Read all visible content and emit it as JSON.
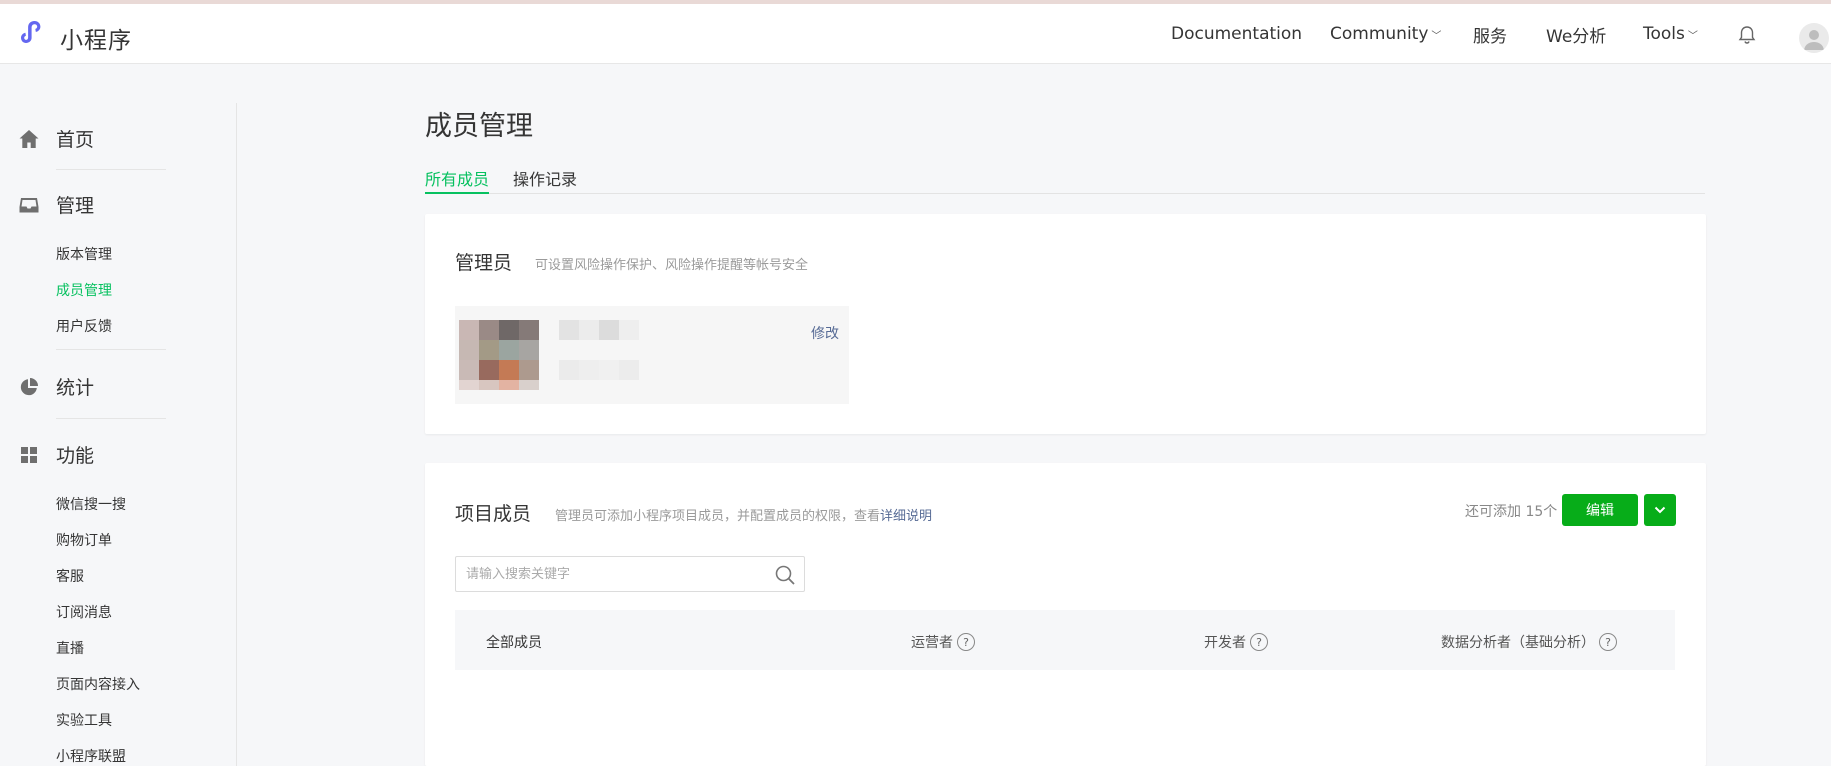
{
  "header": {
    "brand": "小程序",
    "nav": [
      {
        "label": "Documentation"
      },
      {
        "label": "Community",
        "dropdown": true
      },
      {
        "label": "服务"
      },
      {
        "label": "We分析"
      },
      {
        "label": "Tools",
        "dropdown": true
      }
    ],
    "icons": [
      "logo-icon",
      "bell-icon",
      "avatar"
    ]
  },
  "sidebar": {
    "home": "首页",
    "manage": "管理",
    "manage_items": [
      "版本管理",
      "成员管理",
      "用户反馈"
    ],
    "active_item": "成员管理",
    "stats": "统计",
    "features": "功能",
    "feature_items": [
      "微信搜一搜",
      "购物订单",
      "客服",
      "订阅消息",
      "直播",
      "页面内容接入",
      "实验工具",
      "小程序联盟"
    ]
  },
  "main": {
    "title": "成员管理",
    "tabs": [
      {
        "label": "所有成员",
        "active": true
      },
      {
        "label": "操作记录",
        "active": false
      }
    ],
    "admin": {
      "title": "管理员",
      "desc": "可设置风险操作保护、风险操作提醒等帐号安全",
      "edit_label": "修改"
    },
    "members": {
      "title": "项目成员",
      "desc_prefix": "管理员可添加小程序项目成员，并配置成员的权限，查看",
      "desc_link": "详细说明",
      "remaining": "还可添加 15个",
      "edit_button": "编辑",
      "dropdown_icon": "chevron-down-icon",
      "search_placeholder": "请输入搜索关键字",
      "columns": [
        {
          "label": "全部成员",
          "help": false
        },
        {
          "label": "运营者",
          "help": true
        },
        {
          "label": "开发者",
          "help": true
        },
        {
          "label": "数据分析者（基础分析）",
          "help": true
        }
      ]
    }
  },
  "colors": {
    "accent": "#07c160",
    "button": "#07ad19",
    "link": "#576b95"
  }
}
